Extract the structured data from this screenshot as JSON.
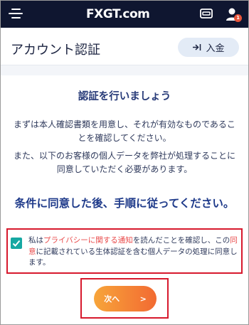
{
  "app": {
    "logo": {
      "part1": "FX",
      "part2": "GT",
      "part3": ".com"
    },
    "notifications": "1",
    "icons": [
      "menu-icon",
      "wallet-icon",
      "user-icon"
    ]
  },
  "header": {
    "title": "アカウント認証",
    "deposit_label": "入金"
  },
  "verification": {
    "heading": "認証を行いましょう",
    "para1": "まずは本人確認書類を用意し、それが有効なものであることを確認してください。",
    "para2": "また、以下のお客様の個人データを弊社が処理することに同意していただく必要があります。",
    "instruction": "条件に同意した後、手順に従ってください。"
  },
  "consent": {
    "checked": true,
    "text_before": "私は",
    "privacy_link": "プライバシーに関する通知",
    "text_middle": "を読んだことを確認し、この",
    "agreement_link": "同意",
    "text_after": "に記載されている生体認証を含む個人データの処理に同意します。"
  },
  "next_button": {
    "label": "次へ",
    "arrow": ">"
  },
  "colors": {
    "topbar": "#0f1630",
    "heading": "#273a78",
    "accent_link": "#e94a4a",
    "checkbox": "#16a8a2",
    "highlight_border": "#d7192d",
    "button_gradient_start": "#f7a53a",
    "button_gradient_end": "#f26a32"
  }
}
